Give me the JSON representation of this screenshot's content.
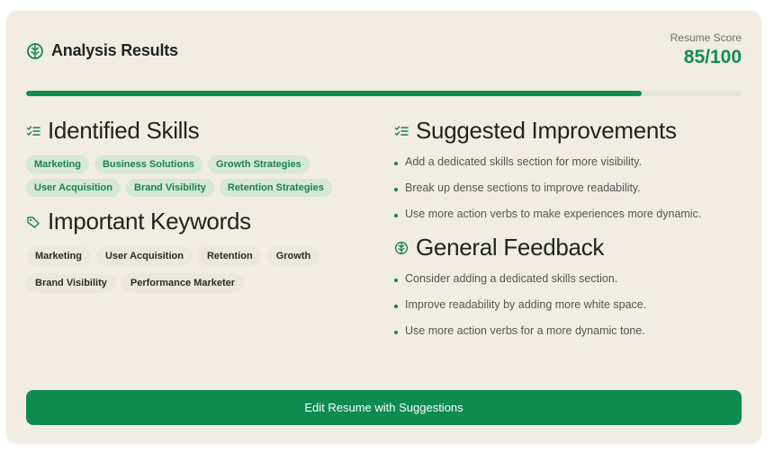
{
  "header": {
    "title": "Analysis Results",
    "icon": "brain-icon"
  },
  "score": {
    "label": "Resume Score",
    "value": "85/100",
    "progress": 0.86
  },
  "colors": {
    "accent": "#0f8f4f",
    "card": "#f1ede2"
  },
  "skills": {
    "title": "Identified Skills",
    "icon": "checklist-icon",
    "items": [
      "Marketing",
      "Business Solutions",
      "Growth Strategies",
      "User Acquisition",
      "Brand Visibility",
      "Retention Strategies"
    ]
  },
  "keywords": {
    "title": "Important Keywords",
    "icon": "tag-icon",
    "items": [
      "Marketing",
      "User Acquisition",
      "Retention",
      "Growth",
      "Brand Visibility",
      "Performance Marketer"
    ]
  },
  "improvements": {
    "title": "Suggested Improvements",
    "icon": "checklist-icon",
    "items": [
      "Add a dedicated skills section for more visibility.",
      "Break up dense sections to improve readability.",
      "Use more action verbs to make experiences more dynamic."
    ]
  },
  "feedback": {
    "title": "General Feedback",
    "icon": "brain-icon",
    "items": [
      "Consider adding a dedicated skills section.",
      "Improve readability by adding more white space.",
      "Use more action verbs for a more dynamic tone."
    ]
  },
  "button": {
    "label": "Edit Resume with Suggestions"
  }
}
